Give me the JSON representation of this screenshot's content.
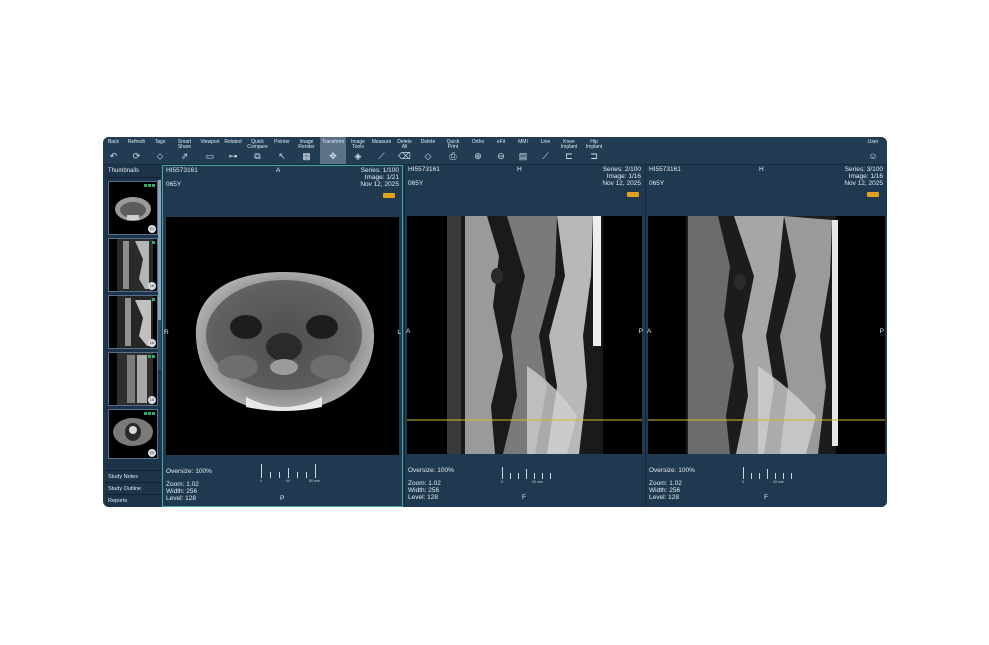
{
  "toolbar": {
    "items": [
      {
        "label": "Back",
        "icon": "↶"
      },
      {
        "label": "Refresh",
        "icon": "⟳"
      },
      {
        "label": "Tags",
        "icon": "⬦"
      },
      {
        "label": "Smart\nShare",
        "icon": "⇗"
      },
      {
        "label": "Viewport",
        "icon": "▭"
      },
      {
        "label": "Related",
        "icon": "⊶"
      },
      {
        "label": "Quick\nCompare",
        "icon": "⧉"
      },
      {
        "label": "Pointer",
        "icon": "↖"
      },
      {
        "label": "Image\nRender",
        "icon": "▦"
      },
      {
        "label": "Transform",
        "icon": "✥"
      },
      {
        "label": "Image\nTools",
        "icon": "◈"
      },
      {
        "label": "Measure",
        "icon": "⟋"
      },
      {
        "label": "Delete\nAll",
        "icon": "⌫"
      },
      {
        "label": "Delete",
        "icon": "◇"
      },
      {
        "label": "Quick\nPrint",
        "icon": "⎙"
      },
      {
        "label": "Ortho",
        "icon": "⊕"
      },
      {
        "label": "eFit",
        "icon": "⊖"
      },
      {
        "label": "MMI",
        "icon": "▤"
      },
      {
        "label": "Line",
        "icon": "⟋"
      },
      {
        "label": "Knee\nImplant",
        "icon": "⊏"
      },
      {
        "label": "Hip\nImplant",
        "icon": "⊐"
      }
    ],
    "user_label": "User",
    "user_icon": "☺"
  },
  "sidebar": {
    "header": "Thumbnails",
    "thumbs": [
      {
        "count": "21"
      },
      {
        "count": "16"
      },
      {
        "count": "16"
      },
      {
        "count": "16"
      },
      {
        "count": "20"
      }
    ],
    "links": [
      "Study Notes",
      "Study Outline",
      "Reports"
    ]
  },
  "viewports": [
    {
      "patient_id": "HI5573161",
      "top_orient": "A",
      "series": "Series: 1/100",
      "image": "Image: 1/21",
      "age": "065Y",
      "date": "Nov 12, 2025",
      "left_orient": "R",
      "right_orient": "L",
      "bottom_orient": "P",
      "oversize": "Oversize: 100%",
      "zoom": "Zoom: 1.02",
      "width": "Width: 256",
      "level": "Level: 128",
      "ruler_labels": [
        "0",
        "40",
        "80 mm"
      ]
    },
    {
      "patient_id": "HI5573161",
      "top_orient": "H",
      "series": "Series: 2/100",
      "image": "Image: 1/16",
      "age": "065Y",
      "date": "Nov 12, 2025",
      "left_orient": "A",
      "right_orient": "P",
      "bottom_orient": "F",
      "oversize": "Oversize: 100%",
      "zoom": "Zoom: 1.02",
      "width": "Width: 256",
      "level": "Level: 128",
      "ruler_labels": [
        "0",
        "40 mm"
      ]
    },
    {
      "patient_id": "HI5573161",
      "top_orient": "H",
      "series": "Series: 3/100",
      "image": "Image: 1/16",
      "age": "065Y",
      "date": "Nov 12, 2025",
      "left_orient": "A",
      "right_orient": "P",
      "bottom_orient": "F",
      "oversize": "Oversize: 100%",
      "zoom": "Zoom: 1.02",
      "width": "Width: 256",
      "level": "Level: 128",
      "ruler_labels": [
        "0",
        "40 mm"
      ]
    }
  ],
  "colors": {
    "app_bg": "#1f3950",
    "selected_border": "#3fa7a0",
    "badge": "#e0a020",
    "reference_line": "#c8c020"
  }
}
